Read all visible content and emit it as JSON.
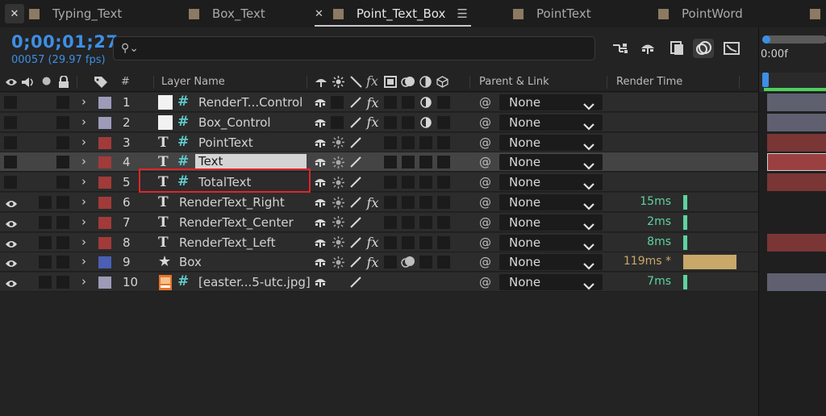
{
  "tabs": [
    {
      "label": "Typing_Text",
      "active": false
    },
    {
      "label": "Box_Text",
      "active": false
    },
    {
      "label": "Point_Text_Box",
      "active": true
    },
    {
      "label": "PointText",
      "active": false
    },
    {
      "label": "PointWord",
      "active": false
    }
  ],
  "header": {
    "timecode": "0;00;01;27",
    "frame_info": "00057 (29.97 fps)",
    "search_placeholder": "",
    "search_value": ""
  },
  "columns": {
    "number": "#",
    "layer_name": "Layer Name",
    "parent_link": "Parent & Link",
    "render_time": "Render Time"
  },
  "timeline": {
    "time_label": "0:00f"
  },
  "colors": {
    "accent_blue": "#3d8fe6",
    "label_red": "#a23a3a",
    "label_lavender": "#9d9bb8",
    "label_blue": "#4a5fb5",
    "render_time_green": "#5fd2a0",
    "render_time_slow": "#c9a86a",
    "highlight_box": "#e0242a"
  },
  "layers": [
    {
      "num": "1",
      "name": "RenderT...Control",
      "type": "solid",
      "label": "lavender",
      "visible": false,
      "fx": true,
      "quality": "half",
      "parent": "None",
      "render_time": "",
      "render_frac": 0,
      "tl": "lavender"
    },
    {
      "num": "2",
      "name": "Box_Control",
      "type": "solid",
      "label": "lavender",
      "visible": false,
      "fx": true,
      "quality": "half",
      "parent": "None",
      "render_time": "",
      "render_frac": 0,
      "tl": "lavender"
    },
    {
      "num": "3",
      "name": "PointText",
      "type": "text3d",
      "label": "red",
      "visible": false,
      "fx": false,
      "quality": "sun",
      "parent": "None",
      "render_time": "",
      "render_frac": 0,
      "tl": "red"
    },
    {
      "num": "4",
      "name": "Text",
      "type": "text3d",
      "label": "red",
      "visible": false,
      "fx": false,
      "quality": "sun",
      "parent": "None",
      "render_time": "",
      "render_frac": 0,
      "tl": "red",
      "selected": true,
      "editing": true
    },
    {
      "num": "5",
      "name": "TotalText",
      "type": "text3d",
      "label": "red",
      "visible": false,
      "fx": false,
      "quality": "sun",
      "parent": "None",
      "render_time": "",
      "render_frac": 0,
      "tl": "red"
    },
    {
      "num": "6",
      "name": "RenderText_Right",
      "type": "text",
      "label": "red",
      "visible": true,
      "fx": true,
      "quality": "sun",
      "parent": "None",
      "render_time": "15ms",
      "render_frac": 0.06,
      "tl": "none"
    },
    {
      "num": "7",
      "name": "RenderText_Center",
      "type": "text",
      "label": "red",
      "visible": true,
      "fx": false,
      "quality": "sun",
      "parent": "None",
      "render_time": "2ms",
      "render_frac": 0.01,
      "tl": "none"
    },
    {
      "num": "8",
      "name": "RenderText_Left",
      "type": "text",
      "label": "red",
      "visible": true,
      "fx": true,
      "quality": "sun",
      "parent": "None",
      "render_time": "8ms",
      "render_frac": 0.04,
      "tl": "red"
    },
    {
      "num": "9",
      "name": "Box",
      "type": "shape",
      "label": "blue",
      "visible": true,
      "fx": true,
      "quality": "sun",
      "motionblur": true,
      "parent": "None",
      "render_time": "119ms *",
      "render_frac": 1.0,
      "slow": true,
      "tl": "none"
    },
    {
      "num": "10",
      "name": "[easter...5-utc.jpg]",
      "type": "image",
      "label": "lavender",
      "visible": true,
      "fx": false,
      "quality": "none",
      "parent": "None",
      "render_time": "7ms",
      "render_frac": 0.03,
      "tl": "lavender"
    }
  ]
}
